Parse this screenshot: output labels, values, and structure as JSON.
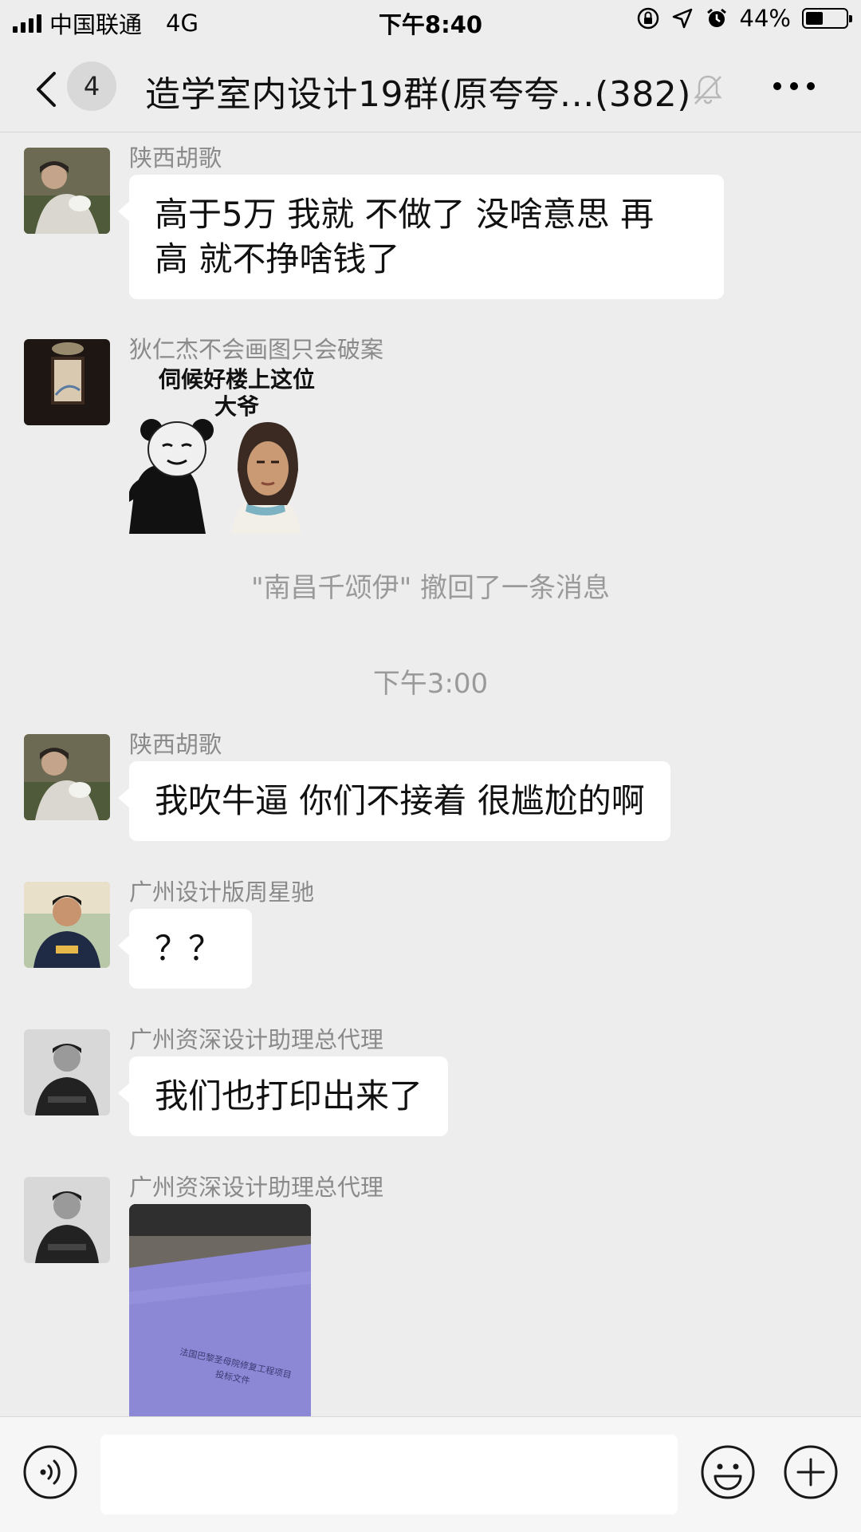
{
  "status_bar": {
    "carrier": "中国联通",
    "network": "4G",
    "time": "下午8:40",
    "battery_percent_label": "44%",
    "battery_level": 0.44
  },
  "nav": {
    "back_icon": "chevron-left-icon",
    "unread_count": "4",
    "title": "造学室内设计19群(原夸夸…(382)",
    "mute_icon": "bell-muted-icon",
    "more_icon": "ellipsis-icon"
  },
  "messages": [
    {
      "sender": "陕西胡歌",
      "lines": [
        "高于5万 我就 不做了  没啥意思  再",
        "高 就不挣啥钱了"
      ]
    },
    {
      "sender": "狄仁杰不会画图只会破案",
      "sticker_caption": [
        "伺候好楼上这位",
        "大爷"
      ]
    },
    {
      "system": "\"南昌千颂伊\" 撤回了一条消息"
    },
    {
      "timestamp": "下午3:00"
    },
    {
      "sender": "陕西胡歌",
      "lines": [
        "我吹牛逼  你们不接着  很尴尬的啊"
      ]
    },
    {
      "sender": "广州设计版周星驰",
      "lines": [
        "？？"
      ]
    },
    {
      "sender": "广州资深设计助理总代理",
      "lines": [
        "我们也打印出来了"
      ]
    },
    {
      "sender": "广州资深设计助理总代理",
      "photo_text": [
        "法国巴黎圣母院修复工程项目",
        "投标文件"
      ]
    }
  ],
  "input_bar": {
    "voice_icon": "voice-icon",
    "placeholder": "",
    "emoji_icon": "emoji-icon",
    "plus_icon": "plus-icon"
  }
}
